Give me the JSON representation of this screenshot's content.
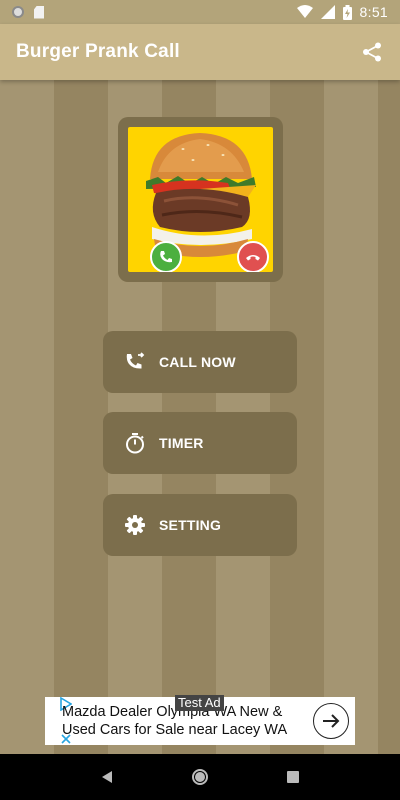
{
  "status_bar": {
    "time": "8:51",
    "icons": [
      "circle-icon",
      "sd-card-icon",
      "wifi-icon",
      "signal-icon",
      "battery-charging-icon"
    ]
  },
  "app_bar": {
    "title": "Burger Prank Call",
    "share_icon": "share-icon"
  },
  "caller_image": {
    "description_icons": [
      "answer-call-icon",
      "decline-call-icon"
    ]
  },
  "menu": [
    {
      "label": "CALL NOW",
      "icon": "phone-forward-icon"
    },
    {
      "label": "TIMER",
      "icon": "timer-icon"
    },
    {
      "label": "SETTING",
      "icon": "gear-icon"
    }
  ],
  "ad": {
    "label": "Test Ad",
    "line1": "Mazda Dealer Olympia WA New &",
    "line2": "Used Cars for Sale near Lacey WA",
    "arrow_icon": "arrow-right-icon"
  },
  "nav_bar": {
    "items": [
      "back-icon",
      "home-icon",
      "recents-icon"
    ]
  },
  "colors": {
    "status_bar": "#b3a47a",
    "app_bar": "#c9b78a",
    "button": "#7c6e4c",
    "stripe_light": "#a49572",
    "stripe_dark": "#958561",
    "image_background": "#ffd400"
  }
}
